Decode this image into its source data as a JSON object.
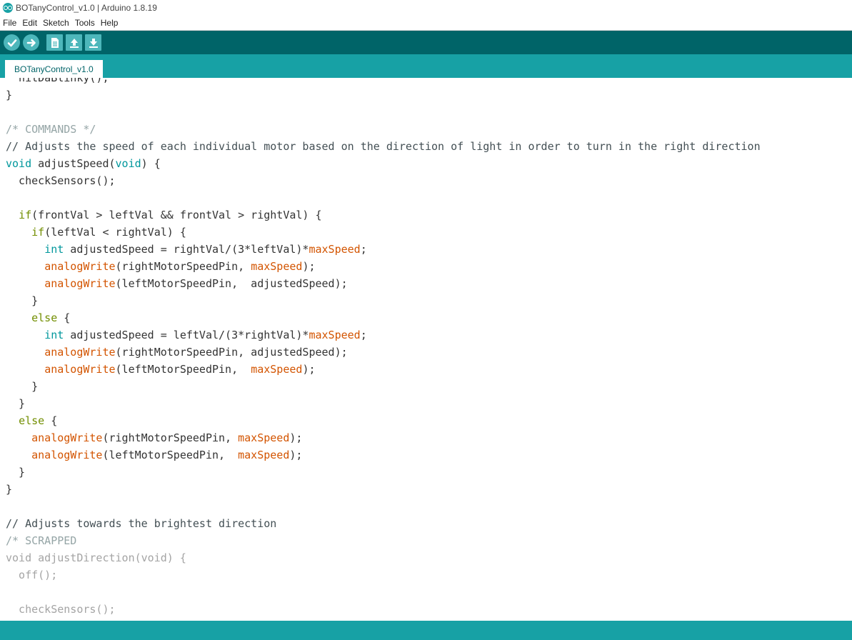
{
  "window": {
    "title": "BOTanyControl_v1.0 | Arduino 1.8.19"
  },
  "menu": [
    "File",
    "Edit",
    "Sketch",
    "Tools",
    "Help"
  ],
  "toolbar": {
    "buttons": [
      "verify",
      "upload",
      "new",
      "open",
      "save"
    ]
  },
  "tabs": [
    "BOTanyControl_v1.0"
  ],
  "colors": {
    "toolbar": "#006468",
    "tabbar": "#17a1a5",
    "comment": "#95a5a6",
    "keyword": "#00979c",
    "function": "#d35400",
    "control": "#728e00"
  },
  "code_lines": [
    [
      {
        "t": "  nitDaBlinky();",
        "c": "plain"
      }
    ],
    [
      {
        "t": "}",
        "c": "plain"
      }
    ],
    [
      {
        "t": "",
        "c": "plain"
      }
    ],
    [
      {
        "t": "/* COMMANDS */",
        "c": "cmt"
      }
    ],
    [
      {
        "t": "// Adjusts the speed of each individual motor based on the direction of light in order to turn in the right direction",
        "c": "com"
      }
    ],
    [
      {
        "t": "void",
        "c": "kw"
      },
      {
        "t": " adjustSpeed(",
        "c": "plain"
      },
      {
        "t": "void",
        "c": "kw"
      },
      {
        "t": ") {",
        "c": "plain"
      }
    ],
    [
      {
        "t": "  checkSensors();",
        "c": "plain"
      }
    ],
    [
      {
        "t": "",
        "c": "plain"
      }
    ],
    [
      {
        "t": "  ",
        "c": "plain"
      },
      {
        "t": "if",
        "c": "ctl"
      },
      {
        "t": "(frontVal > leftVal && frontVal > rightVal) {",
        "c": "plain"
      }
    ],
    [
      {
        "t": "    ",
        "c": "plain"
      },
      {
        "t": "if",
        "c": "ctl"
      },
      {
        "t": "(leftVal < rightVal) {",
        "c": "plain"
      }
    ],
    [
      {
        "t": "      ",
        "c": "plain"
      },
      {
        "t": "int",
        "c": "kw"
      },
      {
        "t": " adjustedSpeed = rightVal/(3*leftVal)*",
        "c": "plain"
      },
      {
        "t": "maxSpeed",
        "c": "var"
      },
      {
        "t": ";",
        "c": "plain"
      }
    ],
    [
      {
        "t": "      ",
        "c": "plain"
      },
      {
        "t": "analogWrite",
        "c": "fn"
      },
      {
        "t": "(rightMotorSpeedPin, ",
        "c": "plain"
      },
      {
        "t": "maxSpeed",
        "c": "var"
      },
      {
        "t": ");",
        "c": "plain"
      }
    ],
    [
      {
        "t": "      ",
        "c": "plain"
      },
      {
        "t": "analogWrite",
        "c": "fn"
      },
      {
        "t": "(leftMotorSpeedPin,  adjustedSpeed);",
        "c": "plain"
      }
    ],
    [
      {
        "t": "    }",
        "c": "plain"
      }
    ],
    [
      {
        "t": "    ",
        "c": "plain"
      },
      {
        "t": "else",
        "c": "ctl"
      },
      {
        "t": " {",
        "c": "plain"
      }
    ],
    [
      {
        "t": "      ",
        "c": "plain"
      },
      {
        "t": "int",
        "c": "kw"
      },
      {
        "t": " adjustedSpeed = leftVal/(3*rightVal)*",
        "c": "plain"
      },
      {
        "t": "maxSpeed",
        "c": "var"
      },
      {
        "t": ";",
        "c": "plain"
      }
    ],
    [
      {
        "t": "      ",
        "c": "plain"
      },
      {
        "t": "analogWrite",
        "c": "fn"
      },
      {
        "t": "(rightMotorSpeedPin, adjustedSpeed);",
        "c": "plain"
      }
    ],
    [
      {
        "t": "      ",
        "c": "plain"
      },
      {
        "t": "analogWrite",
        "c": "fn"
      },
      {
        "t": "(leftMotorSpeedPin,  ",
        "c": "plain"
      },
      {
        "t": "maxSpeed",
        "c": "var"
      },
      {
        "t": ");",
        "c": "plain"
      }
    ],
    [
      {
        "t": "    }",
        "c": "plain"
      }
    ],
    [
      {
        "t": "  }",
        "c": "plain"
      }
    ],
    [
      {
        "t": "  ",
        "c": "plain"
      },
      {
        "t": "else",
        "c": "ctl"
      },
      {
        "t": " {",
        "c": "plain"
      }
    ],
    [
      {
        "t": "    ",
        "c": "plain"
      },
      {
        "t": "analogWrite",
        "c": "fn"
      },
      {
        "t": "(rightMotorSpeedPin, ",
        "c": "plain"
      },
      {
        "t": "maxSpeed",
        "c": "var"
      },
      {
        "t": ");",
        "c": "plain"
      }
    ],
    [
      {
        "t": "    ",
        "c": "plain"
      },
      {
        "t": "analogWrite",
        "c": "fn"
      },
      {
        "t": "(leftMotorSpeedPin,  ",
        "c": "plain"
      },
      {
        "t": "maxSpeed",
        "c": "var"
      },
      {
        "t": ");",
        "c": "plain"
      }
    ],
    [
      {
        "t": "  }",
        "c": "plain"
      }
    ],
    [
      {
        "t": "}",
        "c": "plain"
      }
    ],
    [
      {
        "t": "",
        "c": "plain"
      }
    ],
    [
      {
        "t": "// Adjusts towards the brightest direction",
        "c": "com"
      }
    ],
    [
      {
        "t": "/* SCRAPPED",
        "c": "cmt"
      }
    ],
    [
      {
        "t": "void adjustDirection(void) {",
        "c": "dis"
      }
    ],
    [
      {
        "t": "  off();",
        "c": "dis"
      }
    ],
    [
      {
        "t": "",
        "c": "plain"
      }
    ],
    [
      {
        "t": "  checkSensors();",
        "c": "dis"
      }
    ]
  ]
}
